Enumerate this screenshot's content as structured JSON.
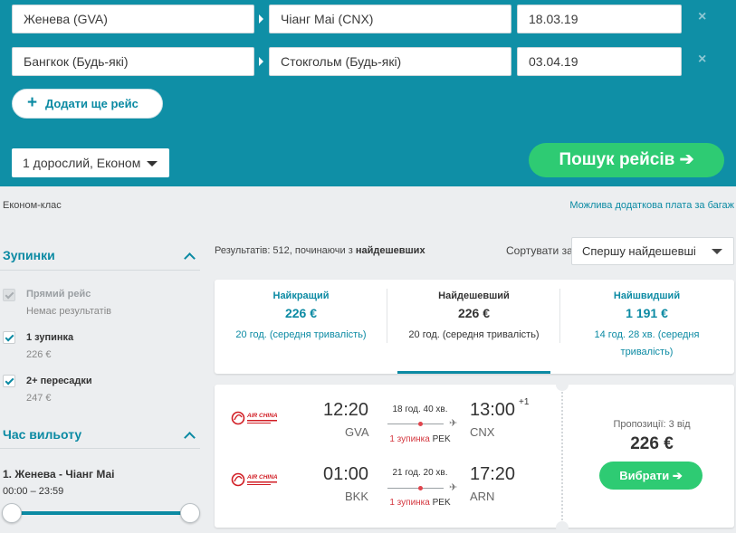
{
  "search": {
    "legs": [
      {
        "origin": "Женева (GVA)",
        "destination": "Чіанг Маі (CNX)",
        "date": "18.03.19"
      },
      {
        "origin": "Бангкок (Будь-які)",
        "destination": "Стокгольм (Будь-які)",
        "date": "03.04.19"
      }
    ],
    "remove_icon": "×",
    "add_flight_icon": "+",
    "add_flight_label": "Додати ще рейс",
    "passengers_label": "1 дорослий, Економ",
    "search_label": "Пошук рейсів ➔",
    "panel_color": "#0f8fa6",
    "accent_color": "#2ecb73"
  },
  "notes": {
    "cabin": "Економ-клас",
    "baggage": "Можлива додаткова плата за багаж"
  },
  "filters": {
    "stops_title": "Зупинки",
    "stops": [
      {
        "label": "Прямий рейс",
        "sub": "Немає результатів",
        "checked": true,
        "disabled": true
      },
      {
        "label": "1 зупинка",
        "sub": "226 €",
        "checked": true,
        "disabled": false
      },
      {
        "label": "2+ пересадки",
        "sub": "247 €",
        "checked": true,
        "disabled": false
      }
    ],
    "departure_title": "Час вильоту",
    "departure_leg": "1. Женева - Чіанг Маі",
    "departure_range": "00:00 – 23:59"
  },
  "results": {
    "count_prefix": "Результатів: 512, починаючи з ",
    "count_sort": "найдешевших",
    "sort_label": "Сортувати за",
    "sort_value": "Спершу найдешевші",
    "tabs": [
      {
        "title": "Найкращий",
        "price": "226 €",
        "duration": "20 год. (середня тривалість)",
        "active": false
      },
      {
        "title": "Найдешевший",
        "price": "226 €",
        "duration": "20 год. (середня тривалість)",
        "active": true
      },
      {
        "title": "Найшвидший",
        "price": "1 191 €",
        "duration": "14 год. 28 хв. (середня тривалість)",
        "active": false
      }
    ],
    "flight": {
      "airline_logo": "AIR CHINA",
      "legs": [
        {
          "dep_time": "12:20",
          "dep_airport": "GVA",
          "duration": "18 год. 40 хв.",
          "stops": "1 зупинка",
          "via": "PEK",
          "arr_time": "13:00",
          "arr_day_offset": "+1",
          "arr_airport": "CNX"
        },
        {
          "dep_time": "01:00",
          "dep_airport": "BKK",
          "duration": "21 год. 20 хв.",
          "stops": "1 зупинка",
          "via": "PEK",
          "arr_time": "17:20",
          "arr_day_offset": "",
          "arr_airport": "ARN"
        }
      ],
      "offers": "Пропозиції: 3 від",
      "price": "226 €",
      "select_label": "Вибрати ➔"
    }
  }
}
